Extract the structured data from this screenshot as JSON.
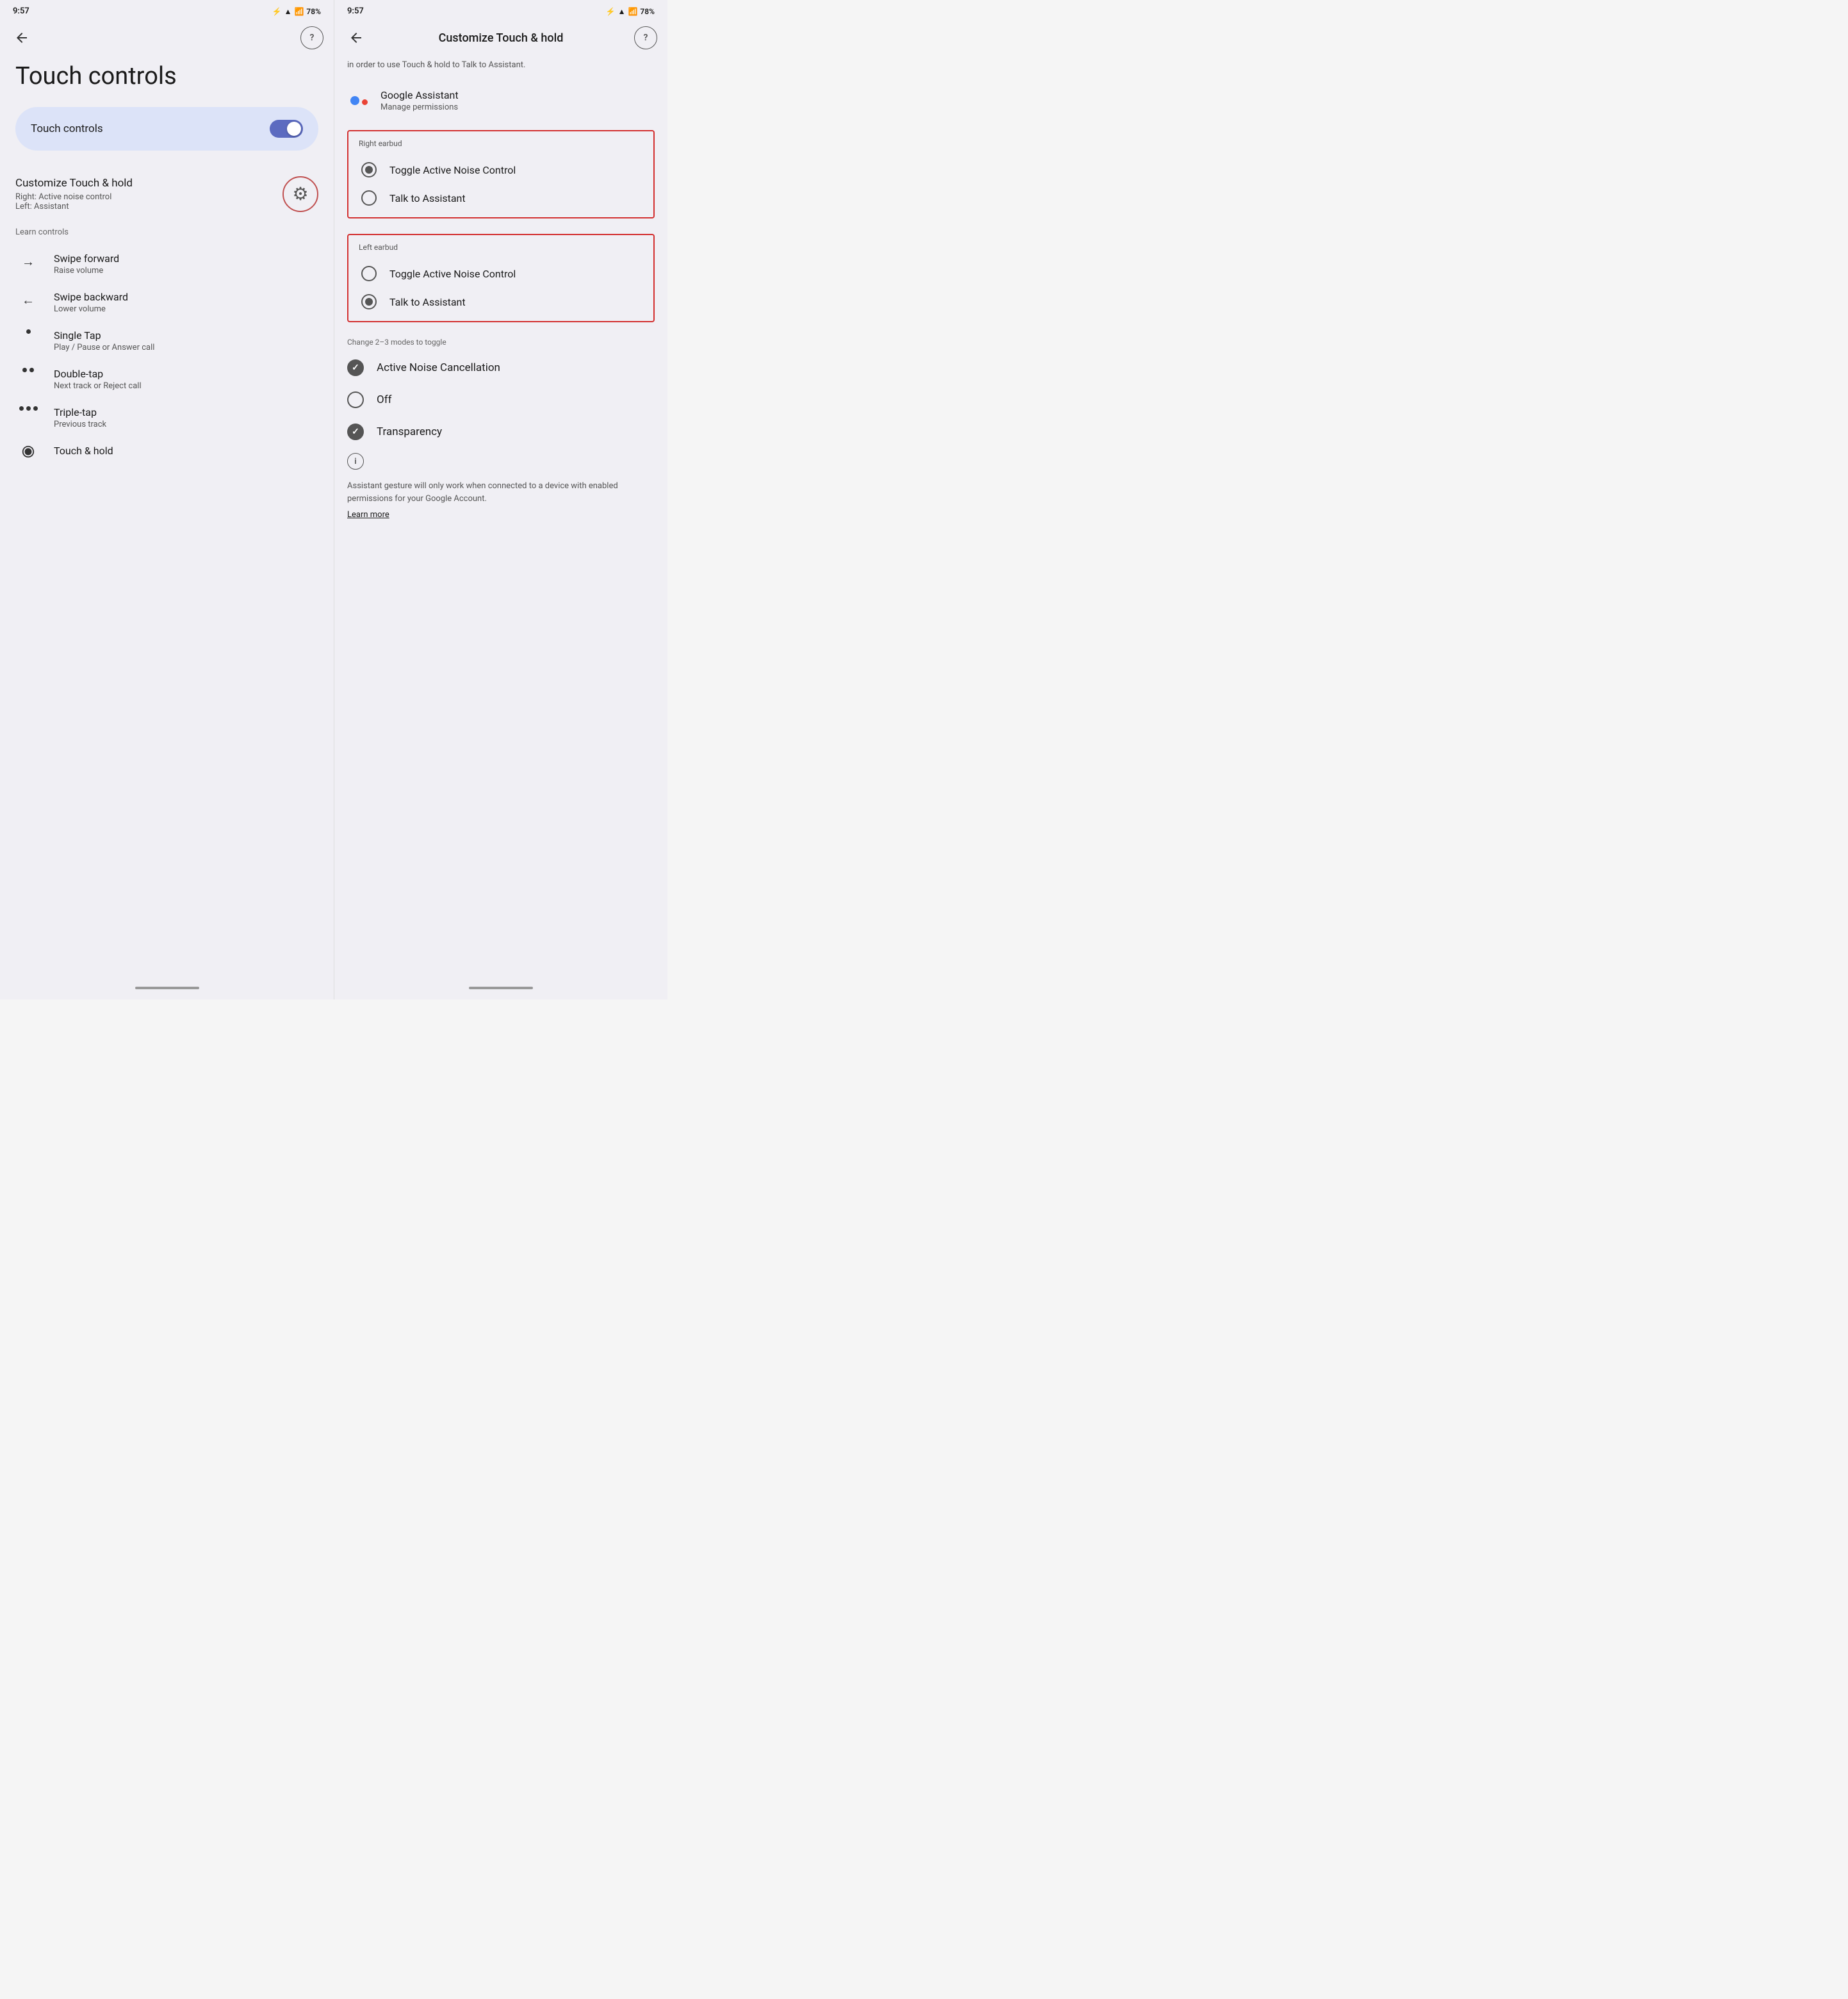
{
  "left_panel": {
    "status_bar": {
      "time": "9:57",
      "battery": "78%"
    },
    "page_title": "Touch controls",
    "toggle_card": {
      "label": "Touch controls",
      "state": "on"
    },
    "customize": {
      "title": "Customize Touch & hold",
      "right_subtitle": "Right: Active noise control",
      "left_subtitle": "Left: Assistant"
    },
    "section_label": "Learn controls",
    "gestures": [
      {
        "icon": "arrow-forward",
        "title": "Swipe forward",
        "subtitle": "Raise volume",
        "dot_count": 0
      },
      {
        "icon": "arrow-back",
        "title": "Swipe backward",
        "subtitle": "Lower volume",
        "dot_count": 0
      },
      {
        "icon": "single-dot",
        "title": "Single Tap",
        "subtitle": "Play / Pause or Answer call",
        "dot_count": 1
      },
      {
        "icon": "double-dot",
        "title": "Double-tap",
        "subtitle": "Next track or Reject call",
        "dot_count": 2
      },
      {
        "icon": "triple-dot",
        "title": "Triple-tap",
        "subtitle": "Previous track",
        "dot_count": 3
      },
      {
        "icon": "touch-hold",
        "title": "Touch & hold",
        "subtitle": "",
        "dot_count": 0
      }
    ]
  },
  "right_panel": {
    "status_bar": {
      "time": "9:57",
      "battery": "78%"
    },
    "title": "Customize Touch & hold",
    "subtitle": "in order to use Touch & hold to Talk to Assistant.",
    "google_assistant": {
      "title": "Google Assistant",
      "subtitle": "Manage permissions"
    },
    "right_earbud": {
      "label": "Right earbud",
      "options": [
        {
          "label": "Toggle Active Noise Control",
          "selected": true
        },
        {
          "label": "Talk to Assistant",
          "selected": false
        }
      ]
    },
    "left_earbud": {
      "label": "Left earbud",
      "options": [
        {
          "label": "Toggle Active Noise Control",
          "selected": false
        },
        {
          "label": "Talk to Assistant",
          "selected": true
        }
      ]
    },
    "change_label": "Change 2–3 modes to toggle",
    "modes": [
      {
        "label": "Active Noise Cancellation",
        "checked": true
      },
      {
        "label": "Off",
        "checked": false
      },
      {
        "label": "Transparency",
        "checked": true
      }
    ],
    "info_text": "Assistant gesture will only work when connected to a device with enabled permissions for your Google Account.",
    "learn_more": "Learn more"
  }
}
